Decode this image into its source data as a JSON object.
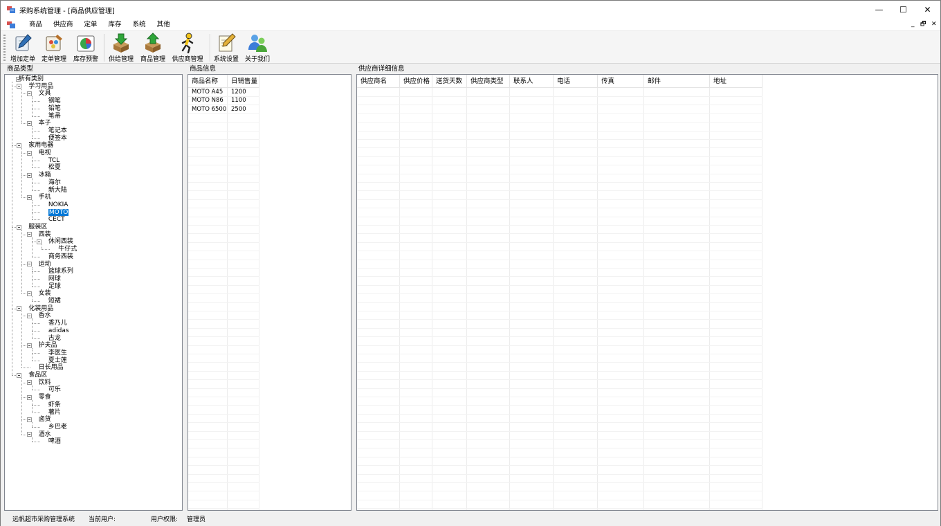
{
  "window": {
    "title": "采购系统管理 - [商品供应管理]",
    "minimize_glyph": "—",
    "maximize_glyph": "☐",
    "close_glyph": "✕"
  },
  "menu": {
    "items": [
      "商品",
      "供应商",
      "定单",
      "库存",
      "系统",
      "其他"
    ],
    "mdi_min": "_",
    "mdi_restore": "🗗",
    "mdi_close": "✕"
  },
  "toolbar": {
    "buttons": [
      {
        "label": "增加定单",
        "icon": "pen-paper-icon"
      },
      {
        "label": "定单管理",
        "icon": "order-palette-icon"
      },
      {
        "label": "库存预警",
        "icon": "pie-chart-icon"
      },
      {
        "label": "供给管理",
        "icon": "box-down-arrow-icon"
      },
      {
        "label": "商品管理",
        "icon": "box-up-arrow-icon"
      },
      {
        "label": "供应商管理",
        "icon": "running-man-icon"
      },
      {
        "label": "系统设置",
        "icon": "pencil-note-icon"
      },
      {
        "label": "关于我们",
        "icon": "users-icon"
      }
    ]
  },
  "panes": {
    "category_title": "商品类型",
    "goods_title": "商品信息",
    "supplier_title": "供应商详细信息"
  },
  "tree": [
    {
      "label": "所有类别"
    },
    {
      "label": "学习用品"
    },
    {
      "label": "文具"
    },
    {
      "label": "钢笔"
    },
    {
      "label": "铅笔"
    },
    {
      "label": "笔帚"
    },
    {
      "label": "本子"
    },
    {
      "label": "笔记本"
    },
    {
      "label": "便签本"
    },
    {
      "label": "家用电器"
    },
    {
      "label": "电视"
    },
    {
      "label": "TCL"
    },
    {
      "label": "松夏"
    },
    {
      "label": "冰箱"
    },
    {
      "label": "海尔"
    },
    {
      "label": "新大陆"
    },
    {
      "label": "手机"
    },
    {
      "label": "NOKIA"
    },
    {
      "label": "MOTO"
    },
    {
      "label": "CECT"
    },
    {
      "label": "服装区"
    },
    {
      "label": "西装"
    },
    {
      "label": "休闲西装"
    },
    {
      "label": "牛仔式"
    },
    {
      "label": "商务西装"
    },
    {
      "label": "运动"
    },
    {
      "label": "篮球系列"
    },
    {
      "label": "网球"
    },
    {
      "label": "足球"
    },
    {
      "label": "女装"
    },
    {
      "label": "短裙"
    },
    {
      "label": "化装用品"
    },
    {
      "label": "香水"
    },
    {
      "label": "香乃儿"
    },
    {
      "label": "adidas"
    },
    {
      "label": "古龙"
    },
    {
      "label": "护夫品"
    },
    {
      "label": "李医生"
    },
    {
      "label": "夏士莲"
    },
    {
      "label": "日长用品"
    },
    {
      "label": "食品区"
    },
    {
      "label": "饮料"
    },
    {
      "label": "可乐"
    },
    {
      "label": "零食"
    },
    {
      "label": "虾条"
    },
    {
      "label": "薯片"
    },
    {
      "label": "卤货"
    },
    {
      "label": "乡巴老"
    },
    {
      "label": "酒水"
    },
    {
      "label": "啤酒"
    }
  ],
  "goods": {
    "columns": [
      "商品名称",
      "日销售量"
    ],
    "rows": [
      [
        "MOTO A45",
        "1200"
      ],
      [
        "MOTO N86",
        "1100"
      ],
      [
        "MOTO 6500",
        "2500"
      ]
    ]
  },
  "supplier": {
    "columns": [
      "供应商名",
      "供应价格",
      "送货天数",
      "供应商类型",
      "联系人",
      "电话",
      "传真",
      "邮件",
      "地址"
    ]
  },
  "status": {
    "system_name": "远帆超市采购管理系统",
    "current_user_label": "当前用户:",
    "current_user_value": "",
    "permission_label": "用户权限:",
    "permission_value": "管理员"
  }
}
